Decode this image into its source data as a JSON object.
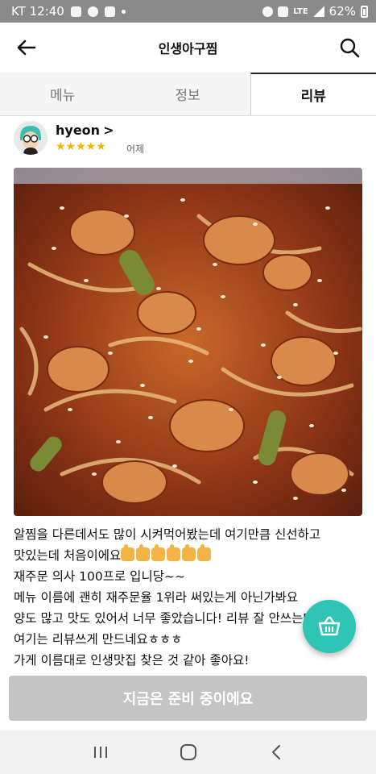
{
  "status_bar": {
    "carrier_time": "KT 12:40",
    "network": "LTE",
    "battery": "62%"
  },
  "app_bar": {
    "title": "인생아구찜",
    "back_icon": "arrow-left-icon",
    "search_icon": "search-icon"
  },
  "tabs": [
    {
      "label": "메뉴",
      "active": false
    },
    {
      "label": "정보",
      "active": false
    },
    {
      "label": "리뷰",
      "active": true
    }
  ],
  "review": {
    "username": "hyeon",
    "chevron": ">",
    "stars": "★★★★★",
    "rating": 5,
    "date": "어제",
    "lines": [
      "알찜을 다른데서도 많이 시켜먹어봤는데 여기만큼 신선하고",
      "맛있는데 처음이에요",
      "재주문 의사 100프로 입니당~~",
      "메뉴 이름에 괜히 재주문율 1위라 써있는게 아닌가봐요",
      "양도 많고 맛도 있어서 너무 좋았습니다! 리뷰 잘 안쓰는데",
      "여기는 리뷰쓰게 만드네요ㅎㅎㅎ",
      "가게 이름대로 인생맛집 찾은 것 같아 좋아요!"
    ]
  },
  "cart_icon": "basket-icon",
  "cta": {
    "label": "지금은 준비 중이에요"
  },
  "colors": {
    "accent": "#2ec4b6",
    "star": "#f4b400",
    "cta_disabled": "#c4c4c4"
  }
}
